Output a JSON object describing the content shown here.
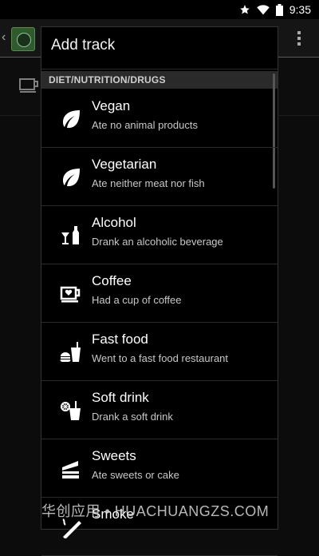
{
  "status": {
    "time": "9:35"
  },
  "dialog": {
    "title": "Add track",
    "section": "DIET/NUTRITION/DRUGS",
    "items": [
      {
        "title": "Vegan",
        "subtitle": "Ate no animal products",
        "icon": "leaf-icon"
      },
      {
        "title": "Vegetarian",
        "subtitle": "Ate neither meat nor fish",
        "icon": "leaf-icon"
      },
      {
        "title": "Alcohol",
        "subtitle": "Drank an alcoholic beverage",
        "icon": "alcohol-icon"
      },
      {
        "title": "Coffee",
        "subtitle": "Had a cup of coffee",
        "icon": "coffee-icon"
      },
      {
        "title": "Fast food",
        "subtitle": "Went to a fast food restaurant",
        "icon": "fast-food-icon"
      },
      {
        "title": "Soft drink",
        "subtitle": "Drank a soft drink",
        "icon": "soft-drink-icon"
      },
      {
        "title": "Sweets",
        "subtitle": "Ate sweets or cake",
        "icon": "cake-icon"
      },
      {
        "title": "Smoke",
        "subtitle": "",
        "icon": "cigarette-icon"
      }
    ]
  },
  "watermark": "华创应用 • HUACHUANGZS.COM"
}
